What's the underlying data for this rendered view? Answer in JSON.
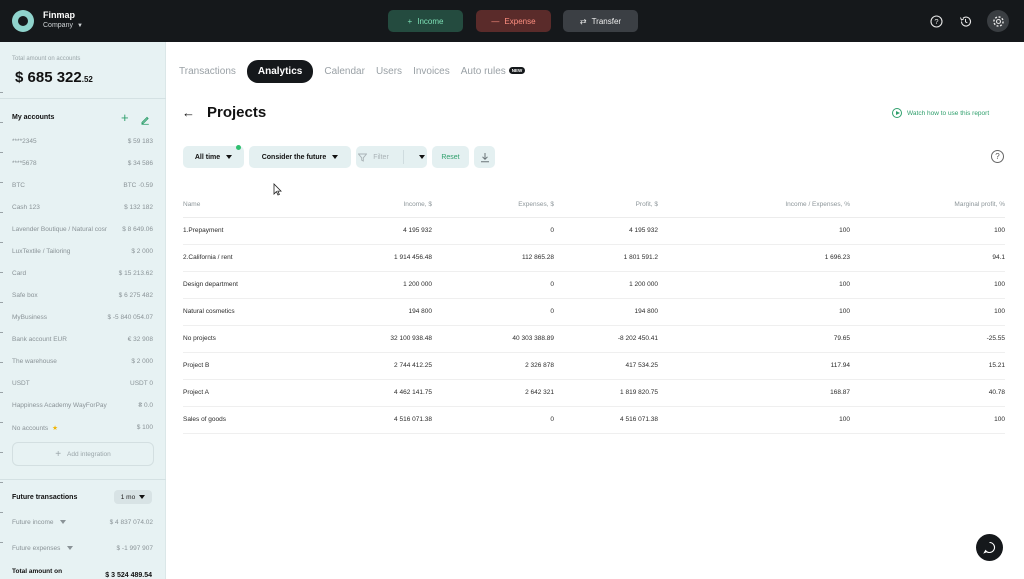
{
  "app": {
    "brand": "Finmap",
    "company": "Company"
  },
  "topbar": {
    "income_label": "Income",
    "expense_label": "Expense",
    "transfer_label": "Transfer",
    "income_icon": "plus-icon",
    "expense_icon": "minus-icon",
    "transfer_icon": "transfer-arrows-icon",
    "right_icons": [
      "help-icon",
      "history-icon",
      "settings-icon"
    ]
  },
  "sidebar": {
    "total_label": "Total amount on accounts",
    "total_currency": "$",
    "total_main": "685 322",
    "total_cents": ".52",
    "accounts_title": "My accounts",
    "accounts": [
      {
        "name": "****2345",
        "balance": "$ 59 183"
      },
      {
        "name": "****5678",
        "balance": "$ 34 586"
      },
      {
        "name": "BTC",
        "balance": "BTC ·0.59"
      },
      {
        "name": "Cash 123",
        "balance": "$ 132 182"
      },
      {
        "name": "Lavender Boutique / Natural cosmetics",
        "balance": "$ 8 649.06"
      },
      {
        "name": "LuxTextile / Tailoring",
        "balance": "$ 2 000"
      },
      {
        "name": "Card",
        "balance": "$ 15 213.62"
      },
      {
        "name": "Safe box",
        "balance": "$ 6 275 482"
      },
      {
        "name": "MyBusiness",
        "balance": "$ -5 840 054.07"
      },
      {
        "name": "Bank account EUR",
        "balance": "€ 32 908"
      },
      {
        "name": "The warehouse",
        "balance": "$ 2 000"
      },
      {
        "name": "USDT",
        "balance": "USDT 0"
      },
      {
        "name": "Happiness Academy WayForPay",
        "balance": "₴ 0.0"
      },
      {
        "name": "No accounts",
        "balance": "$ 100",
        "starred": true
      }
    ],
    "add_integration": "Add integration",
    "future_title": "Future transactions",
    "period": "1 mo",
    "future_income_label": "Future income",
    "future_income_value": "$ 4 837 074.02",
    "future_expenses_label": "Future expenses",
    "future_expenses_value": "$ -1 997 907",
    "future_total_label": "Total amount on",
    "future_total_value": "$ 3 524 489.54"
  },
  "main": {
    "tabs": [
      "Transactions",
      "Analytics",
      "Calendar",
      "Users",
      "Invoices",
      "Auto rules"
    ],
    "active_tab": "Analytics",
    "new_badge": "NEW",
    "title": "Projects",
    "watch_link": "Watch how to use this report",
    "filters": {
      "period": "All time",
      "future": "Consider the future",
      "filter": "Filter",
      "reset": "Reset"
    },
    "table": {
      "headers": [
        "Name",
        "Income, $",
        "Expenses, $",
        "Profit, $",
        "Income / Expenses, %",
        "Marginal profit, %"
      ],
      "rows": [
        [
          "1.Prepayment",
          "4 195 932",
          "0",
          "4 195 932",
          "100",
          "100"
        ],
        [
          "2.California / rent",
          "1 914 456.48",
          "112 865.28",
          "1 801 591.2",
          "1 696.23",
          "94.1"
        ],
        [
          "Design department",
          "1 200 000",
          "0",
          "1 200 000",
          "100",
          "100"
        ],
        [
          "Natural cosmetics",
          "194 800",
          "0",
          "194 800",
          "100",
          "100"
        ],
        [
          "No projects",
          "32 100 938.48",
          "40 303 388.89",
          "-8 202 450.41",
          "79.65",
          "-25.55"
        ],
        [
          "Project B",
          "2 744 412.25",
          "2 326 878",
          "417 534.25",
          "117.94",
          "15.21"
        ],
        [
          "Project A",
          "4 462 141.75",
          "2 642 321",
          "1 819 820.75",
          "168.87",
          "40.78"
        ],
        [
          "Sales of goods",
          "4 516 071.38",
          "0",
          "4 516 071.38",
          "100",
          "100"
        ]
      ]
    }
  }
}
